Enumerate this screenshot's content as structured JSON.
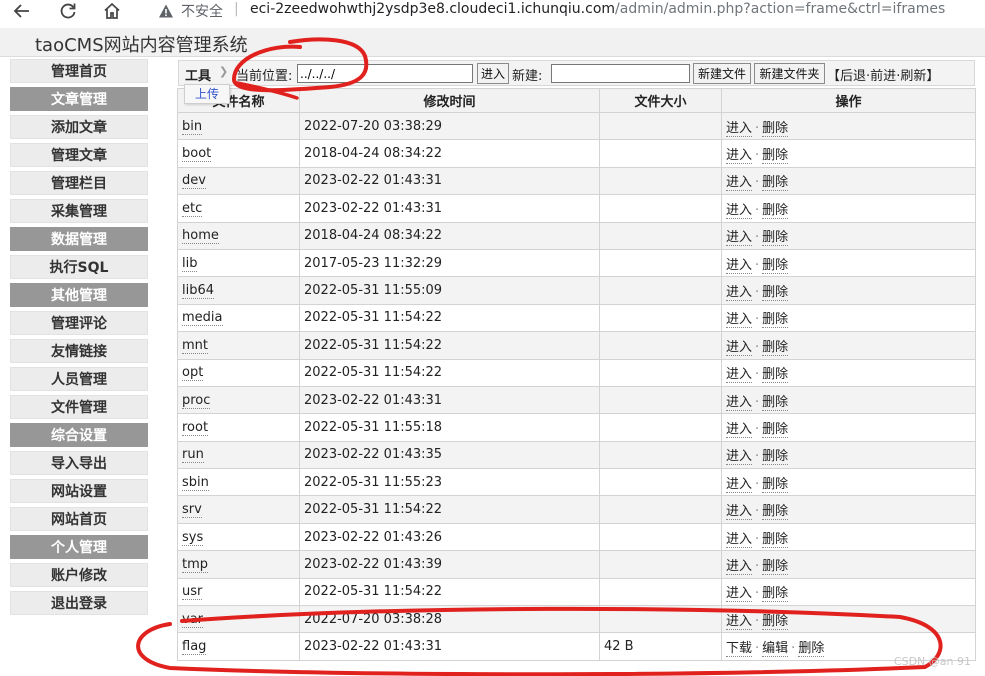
{
  "browser": {
    "insecure_label": "不安全",
    "separator": "|",
    "url_host": "eci-2zeedwohwthj2ysdp3e8.cloudeci1.ichunqiu.com",
    "url_path": "/admin/admin.php?action=frame&ctrl=iframes"
  },
  "app": {
    "title": "taoCMS网站内容管理系统"
  },
  "sidebar": {
    "items": [
      {
        "label": "管理首页",
        "kind": "link"
      },
      {
        "label": "文章管理",
        "kind": "head"
      },
      {
        "label": "添加文章",
        "kind": "link"
      },
      {
        "label": "管理文章",
        "kind": "link"
      },
      {
        "label": "管理栏目",
        "kind": "link"
      },
      {
        "label": "采集管理",
        "kind": "link"
      },
      {
        "label": "数据管理",
        "kind": "head"
      },
      {
        "label": "执行SQL",
        "kind": "link"
      },
      {
        "label": "其他管理",
        "kind": "head"
      },
      {
        "label": "管理评论",
        "kind": "link"
      },
      {
        "label": "友情链接",
        "kind": "link"
      },
      {
        "label": "人员管理",
        "kind": "link"
      },
      {
        "label": "文件管理",
        "kind": "link"
      },
      {
        "label": "综合设置",
        "kind": "head"
      },
      {
        "label": "导入导出",
        "kind": "link"
      },
      {
        "label": "网站设置",
        "kind": "link"
      },
      {
        "label": "网站首页",
        "kind": "link"
      },
      {
        "label": "个人管理",
        "kind": "head"
      },
      {
        "label": "账户修改",
        "kind": "link"
      },
      {
        "label": "退出登录",
        "kind": "link"
      }
    ]
  },
  "toolbar": {
    "tool_label": "工具",
    "location_label": "当前位置:",
    "path_value": "../../../",
    "enter_label": "进入",
    "new_label": "新建:",
    "new_value": "",
    "newfile_label": "新建文件",
    "newfolder_label": "新建文件夹",
    "bracket_open": "【",
    "back_label": "后退",
    "forward_label": "前进",
    "refresh_label": "刷新",
    "bracket_close": "】",
    "nav_sep": "·",
    "upload_label": "上传"
  },
  "table": {
    "headers": [
      "文件名称",
      "修改时间",
      "文件大小",
      "操作"
    ],
    "op_enter": "进入",
    "op_delete": "删除",
    "op_download": "下载",
    "op_edit": "编辑",
    "rows": [
      {
        "name": "bin",
        "time": "2022-07-20 03:38:29",
        "size": ""
      },
      {
        "name": "boot",
        "time": "2018-04-24 08:34:22",
        "size": ""
      },
      {
        "name": "dev",
        "time": "2023-02-22 01:43:31",
        "size": ""
      },
      {
        "name": "etc",
        "time": "2023-02-22 01:43:31",
        "size": ""
      },
      {
        "name": "home",
        "time": "2018-04-24 08:34:22",
        "size": ""
      },
      {
        "name": "lib",
        "time": "2017-05-23 11:32:29",
        "size": ""
      },
      {
        "name": "lib64",
        "time": "2022-05-31 11:55:09",
        "size": ""
      },
      {
        "name": "media",
        "time": "2022-05-31 11:54:22",
        "size": ""
      },
      {
        "name": "mnt",
        "time": "2022-05-31 11:54:22",
        "size": ""
      },
      {
        "name": "opt",
        "time": "2022-05-31 11:54:22",
        "size": ""
      },
      {
        "name": "proc",
        "time": "2023-02-22 01:43:31",
        "size": ""
      },
      {
        "name": "root",
        "time": "2022-05-31 11:55:18",
        "size": ""
      },
      {
        "name": "run",
        "time": "2023-02-22 01:43:35",
        "size": ""
      },
      {
        "name": "sbin",
        "time": "2022-05-31 11:55:23",
        "size": ""
      },
      {
        "name": "srv",
        "time": "2022-05-31 11:54:22",
        "size": ""
      },
      {
        "name": "sys",
        "time": "2023-02-22 01:43:26",
        "size": ""
      },
      {
        "name": "tmp",
        "time": "2023-02-22 01:43:39",
        "size": ""
      },
      {
        "name": "usr",
        "time": "2022-05-31 11:54:22",
        "size": ""
      },
      {
        "name": "var",
        "time": "2022-07-20 03:38:28",
        "size": ""
      },
      {
        "name": "flag",
        "time": "2023-02-22 01:43:31",
        "size": "42 B",
        "is_file": true
      }
    ]
  },
  "watermark": "CSDN @an 91",
  "colors": {
    "annotation_red": "#e0211d",
    "sidebar_head": "#979797"
  }
}
